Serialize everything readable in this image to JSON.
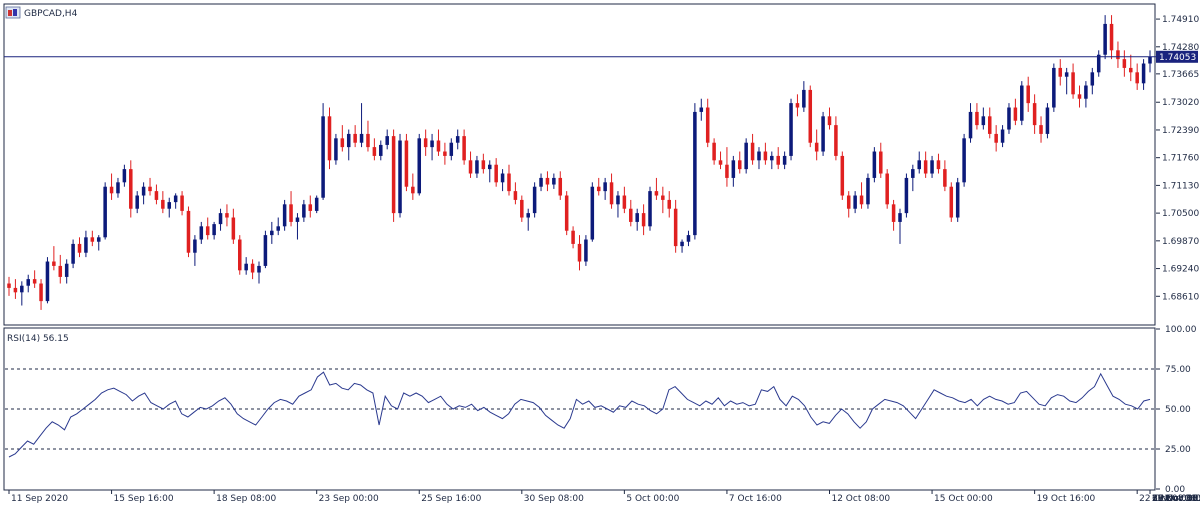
{
  "window": {
    "symbol_title": "GBPCAD,H4",
    "icon": "chart-window-icon"
  },
  "colors": {
    "bull": "#0c1a7a",
    "bear": "#e02020",
    "axis": "#1f2a44",
    "bid_line": "#1a237e",
    "rsi_line": "#2b3a8f",
    "price_tag_bg": "#1a237e",
    "price_tag_text": "#ffffff"
  },
  "chart_data": [
    {
      "type": "candlestick",
      "title": "GBPCAD,H4",
      "ylim": [
        1.6798,
        1.7523
      ],
      "y_ticks": [
        "1.74910",
        "1.74280",
        "1.73665",
        "1.73020",
        "1.72390",
        "1.71760",
        "1.71130",
        "1.70500",
        "1.69870",
        "1.69240",
        "1.68610"
      ],
      "current_price": "1.74053",
      "x_ticks": [
        "11 Sep 2020",
        "15 Sep 16:00",
        "18 Sep 08:00",
        "23 Sep 00:00",
        "25 Sep 16:00",
        "30 Sep 08:00",
        "5 Oct 00:00",
        "7 Oct 16:00",
        "12 Oct 08:00",
        "15 Oct 00:00",
        "19 Oct 16:00",
        "22 Oct 08:00",
        "27 Oct 00:00",
        "29 Oct 16:00",
        "3 Nov 08:00",
        "6 Nov 00:00",
        "10 Nov 16:00",
        "13 Nov 08:00",
        "18 Nov 00:00",
        "20 Nov 16:00",
        "25 Nov 08:00"
      ],
      "x_tick_candle_index": [
        0,
        16,
        32,
        48,
        64,
        80,
        96,
        112,
        128,
        144,
        160,
        176,
        192,
        208,
        224,
        240,
        256,
        272,
        288,
        304,
        320
      ],
      "candles_ohlc": [
        [
          1.689,
          1.6905,
          1.6862,
          1.688
        ],
        [
          1.688,
          1.69,
          1.6855,
          1.687
        ],
        [
          1.687,
          1.6895,
          1.684,
          1.6885
        ],
        [
          1.6885,
          1.691,
          1.687,
          1.69
        ],
        [
          1.69,
          1.692,
          1.688,
          1.689
        ],
        [
          1.689,
          1.69,
          1.683,
          1.685
        ],
        [
          1.685,
          1.695,
          1.6845,
          1.694
        ],
        [
          1.694,
          1.6975,
          1.692,
          1.693
        ],
        [
          1.693,
          1.6955,
          1.689,
          1.6905
        ],
        [
          1.6905,
          1.6945,
          1.689,
          1.6935
        ],
        [
          1.6935,
          1.699,
          1.6925,
          1.698
        ],
        [
          1.698,
          1.6995,
          1.695,
          1.696
        ],
        [
          1.696,
          1.701,
          1.695,
          1.6995
        ],
        [
          1.6995,
          1.701,
          1.6975,
          1.6985
        ],
        [
          1.6985,
          1.7,
          1.6965,
          1.6995
        ],
        [
          1.6995,
          1.712,
          1.699,
          1.711
        ],
        [
          1.711,
          1.714,
          1.708,
          1.7095
        ],
        [
          1.7095,
          1.713,
          1.7085,
          1.712
        ],
        [
          1.712,
          1.716,
          1.711,
          1.715
        ],
        [
          1.715,
          1.717,
          1.704,
          1.706
        ],
        [
          1.706,
          1.71,
          1.705,
          1.709
        ],
        [
          1.709,
          1.712,
          1.707,
          1.711
        ],
        [
          1.711,
          1.713,
          1.709,
          1.71
        ],
        [
          1.71,
          1.7115,
          1.707,
          1.708
        ],
        [
          1.708,
          1.71,
          1.705,
          1.706
        ],
        [
          1.706,
          1.7085,
          1.704,
          1.7075
        ],
        [
          1.7075,
          1.7095,
          1.706,
          1.709
        ],
        [
          1.709,
          1.71,
          1.7045,
          1.7055
        ],
        [
          1.7055,
          1.7065,
          1.695,
          1.696
        ],
        [
          1.696,
          1.7,
          1.693,
          1.699
        ],
        [
          1.699,
          1.703,
          1.698,
          1.702
        ],
        [
          1.702,
          1.704,
          1.699,
          1.7
        ],
        [
          1.7,
          1.703,
          1.699,
          1.7025
        ],
        [
          1.7025,
          1.706,
          1.701,
          1.705
        ],
        [
          1.705,
          1.707,
          1.702,
          1.704
        ],
        [
          1.704,
          1.706,
          1.698,
          1.699
        ],
        [
          1.699,
          1.7,
          1.691,
          1.692
        ],
        [
          1.692,
          1.695,
          1.691,
          1.6935
        ],
        [
          1.6935,
          1.6945,
          1.69,
          1.6915
        ],
        [
          1.6915,
          1.694,
          1.689,
          1.693
        ],
        [
          1.693,
          1.701,
          1.6925,
          1.7
        ],
        [
          1.7,
          1.703,
          1.698,
          1.701
        ],
        [
          1.701,
          1.704,
          1.7,
          1.702
        ],
        [
          1.702,
          1.708,
          1.701,
          1.707
        ],
        [
          1.707,
          1.71,
          1.702,
          1.703
        ],
        [
          1.703,
          1.705,
          1.699,
          1.704
        ],
        [
          1.704,
          1.708,
          1.703,
          1.707
        ],
        [
          1.707,
          1.709,
          1.704,
          1.7055
        ],
        [
          1.7055,
          1.709,
          1.705,
          1.7085
        ],
        [
          1.7085,
          1.73,
          1.708,
          1.727
        ],
        [
          1.727,
          1.729,
          1.715,
          1.717
        ],
        [
          1.717,
          1.723,
          1.716,
          1.722
        ],
        [
          1.722,
          1.725,
          1.719,
          1.72
        ],
        [
          1.72,
          1.724,
          1.717,
          1.723
        ],
        [
          1.723,
          1.725,
          1.72,
          1.721
        ],
        [
          1.721,
          1.73,
          1.72,
          1.723
        ],
        [
          1.723,
          1.726,
          1.719,
          1.72
        ],
        [
          1.72,
          1.722,
          1.717,
          1.718
        ],
        [
          1.718,
          1.7215,
          1.717,
          1.7205
        ],
        [
          1.7205,
          1.724,
          1.7195,
          1.7225
        ],
        [
          1.7225,
          1.724,
          1.703,
          1.705
        ],
        [
          1.705,
          1.723,
          1.704,
          1.7215
        ],
        [
          1.7215,
          1.723,
          1.71,
          1.711
        ],
        [
          1.711,
          1.714,
          1.708,
          1.7095
        ],
        [
          1.7095,
          1.723,
          1.709,
          1.722
        ],
        [
          1.722,
          1.724,
          1.718,
          1.72
        ],
        [
          1.72,
          1.723,
          1.717,
          1.7215
        ],
        [
          1.7215,
          1.724,
          1.718,
          1.719
        ],
        [
          1.719,
          1.721,
          1.716,
          1.718
        ],
        [
          1.718,
          1.722,
          1.717,
          1.721
        ],
        [
          1.721,
          1.724,
          1.7195,
          1.7225
        ],
        [
          1.7225,
          1.724,
          1.716,
          1.717
        ],
        [
          1.717,
          1.719,
          1.713,
          1.714
        ],
        [
          1.714,
          1.718,
          1.713,
          1.717
        ],
        [
          1.717,
          1.7185,
          1.714,
          1.715
        ],
        [
          1.715,
          1.717,
          1.712,
          1.716
        ],
        [
          1.716,
          1.7175,
          1.711,
          1.712
        ],
        [
          1.712,
          1.715,
          1.71,
          1.714
        ],
        [
          1.714,
          1.716,
          1.709,
          1.71
        ],
        [
          1.71,
          1.712,
          1.707,
          1.708
        ],
        [
          1.708,
          1.709,
          1.703,
          1.704
        ],
        [
          1.704,
          1.706,
          1.701,
          1.705
        ],
        [
          1.705,
          1.712,
          1.704,
          1.711
        ],
        [
          1.711,
          1.714,
          1.71,
          1.713
        ],
        [
          1.713,
          1.7145,
          1.71,
          1.7115
        ],
        [
          1.7115,
          1.714,
          1.7105,
          1.713
        ],
        [
          1.713,
          1.7145,
          1.708,
          1.709
        ],
        [
          1.709,
          1.71,
          1.7,
          1.701
        ],
        [
          1.701,
          1.702,
          1.697,
          1.698
        ],
        [
          1.698,
          1.7,
          1.692,
          1.694
        ],
        [
          1.694,
          1.7,
          1.693,
          1.699
        ],
        [
          1.699,
          1.712,
          1.6985,
          1.711
        ],
        [
          1.711,
          1.713,
          1.709,
          1.71
        ],
        [
          1.71,
          1.713,
          1.708,
          1.712
        ],
        [
          1.712,
          1.714,
          1.706,
          1.707
        ],
        [
          1.707,
          1.71,
          1.704,
          1.709
        ],
        [
          1.709,
          1.711,
          1.705,
          1.706
        ],
        [
          1.706,
          1.708,
          1.702,
          1.703
        ],
        [
          1.703,
          1.706,
          1.701,
          1.705
        ],
        [
          1.705,
          1.707,
          1.7,
          1.702
        ],
        [
          1.702,
          1.711,
          1.701,
          1.71
        ],
        [
          1.71,
          1.713,
          1.708,
          1.709
        ],
        [
          1.709,
          1.711,
          1.705,
          1.708
        ],
        [
          1.708,
          1.71,
          1.704,
          1.706
        ],
        [
          1.706,
          1.708,
          1.696,
          1.6975
        ],
        [
          1.6975,
          1.699,
          1.696,
          1.6985
        ],
        [
          1.6985,
          1.701,
          1.6975,
          1.7
        ],
        [
          1.7,
          1.73,
          1.699,
          1.728
        ],
        [
          1.728,
          1.731,
          1.726,
          1.729
        ],
        [
          1.729,
          1.731,
          1.72,
          1.721
        ],
        [
          1.721,
          1.722,
          1.716,
          1.717
        ],
        [
          1.717,
          1.719,
          1.715,
          1.716
        ],
        [
          1.716,
          1.72,
          1.711,
          1.713
        ],
        [
          1.713,
          1.718,
          1.711,
          1.717
        ],
        [
          1.717,
          1.719,
          1.714,
          1.715
        ],
        [
          1.715,
          1.722,
          1.714,
          1.721
        ],
        [
          1.721,
          1.723,
          1.716,
          1.717
        ],
        [
          1.717,
          1.72,
          1.715,
          1.719
        ],
        [
          1.719,
          1.721,
          1.716,
          1.717
        ],
        [
          1.717,
          1.719,
          1.715,
          1.718
        ],
        [
          1.718,
          1.72,
          1.715,
          1.716
        ],
        [
          1.716,
          1.719,
          1.715,
          1.718
        ],
        [
          1.718,
          1.731,
          1.717,
          1.73
        ],
        [
          1.73,
          1.732,
          1.727,
          1.729
        ],
        [
          1.729,
          1.735,
          1.728,
          1.733
        ],
        [
          1.733,
          1.734,
          1.72,
          1.721
        ],
        [
          1.721,
          1.724,
          1.717,
          1.719
        ],
        [
          1.719,
          1.728,
          1.718,
          1.727
        ],
        [
          1.727,
          1.729,
          1.724,
          1.725
        ],
        [
          1.725,
          1.727,
          1.717,
          1.718
        ],
        [
          1.718,
          1.719,
          1.708,
          1.709
        ],
        [
          1.709,
          1.71,
          1.704,
          1.706
        ],
        [
          1.706,
          1.71,
          1.705,
          1.709
        ],
        [
          1.709,
          1.712,
          1.706,
          1.707
        ],
        [
          1.707,
          1.714,
          1.706,
          1.713
        ],
        [
          1.713,
          1.72,
          1.712,
          1.719
        ],
        [
          1.719,
          1.721,
          1.713,
          1.714
        ],
        [
          1.714,
          1.715,
          1.706,
          1.707
        ],
        [
          1.707,
          1.708,
          1.701,
          1.703
        ],
        [
          1.703,
          1.706,
          1.698,
          1.705
        ],
        [
          1.705,
          1.714,
          1.704,
          1.713
        ],
        [
          1.713,
          1.716,
          1.71,
          1.715
        ],
        [
          1.715,
          1.719,
          1.714,
          1.717
        ],
        [
          1.717,
          1.719,
          1.713,
          1.714
        ],
        [
          1.714,
          1.718,
          1.713,
          1.717
        ],
        [
          1.717,
          1.7185,
          1.714,
          1.715
        ],
        [
          1.715,
          1.717,
          1.71,
          1.711
        ],
        [
          1.711,
          1.712,
          1.703,
          1.704
        ],
        [
          1.704,
          1.713,
          1.703,
          1.712
        ],
        [
          1.712,
          1.723,
          1.711,
          1.722
        ],
        [
          1.722,
          1.73,
          1.721,
          1.728
        ],
        [
          1.728,
          1.73,
          1.724,
          1.725
        ],
        [
          1.725,
          1.729,
          1.724,
          1.727
        ],
        [
          1.727,
          1.729,
          1.722,
          1.723
        ],
        [
          1.723,
          1.725,
          1.719,
          1.721
        ],
        [
          1.721,
          1.725,
          1.72,
          1.724
        ],
        [
          1.724,
          1.73,
          1.723,
          1.729
        ],
        [
          1.729,
          1.731,
          1.725,
          1.726
        ],
        [
          1.726,
          1.735,
          1.725,
          1.734
        ],
        [
          1.734,
          1.736,
          1.728,
          1.73
        ],
        [
          1.73,
          1.732,
          1.723,
          1.725
        ],
        [
          1.725,
          1.727,
          1.721,
          1.723
        ],
        [
          1.723,
          1.73,
          1.722,
          1.729
        ],
        [
          1.729,
          1.739,
          1.728,
          1.738
        ],
        [
          1.738,
          1.74,
          1.734,
          1.736
        ],
        [
          1.736,
          1.738,
          1.732,
          1.737
        ],
        [
          1.737,
          1.739,
          1.731,
          1.732
        ],
        [
          1.732,
          1.734,
          1.729,
          1.731
        ],
        [
          1.731,
          1.735,
          1.729,
          1.734
        ],
        [
          1.734,
          1.738,
          1.732,
          1.737
        ],
        [
          1.737,
          1.742,
          1.736,
          1.741
        ],
        [
          1.741,
          1.75,
          1.74,
          1.748
        ],
        [
          1.748,
          1.75,
          1.74,
          1.742
        ],
        [
          1.742,
          1.744,
          1.738,
          1.74
        ],
        [
          1.74,
          1.742,
          1.736,
          1.738
        ],
        [
          1.738,
          1.741,
          1.735,
          1.737
        ],
        [
          1.737,
          1.739,
          1.733,
          1.7345
        ],
        [
          1.7345,
          1.74,
          1.733,
          1.739
        ],
        [
          1.739,
          1.742,
          1.737,
          1.7405
        ]
      ]
    },
    {
      "type": "line",
      "title": "RSI(14) 56.15",
      "ylim": [
        0,
        100
      ],
      "y_ticks": [
        "100.00",
        "75.00",
        "50.00",
        "25.00",
        "0.00"
      ],
      "levels": [
        75,
        50,
        25
      ],
      "values": [
        20,
        22,
        26,
        30,
        28,
        33,
        38,
        42,
        40,
        37,
        45,
        47,
        50,
        53,
        56,
        60,
        62,
        63,
        61,
        59,
        55,
        58,
        60,
        54,
        52,
        50,
        53,
        55,
        47,
        45,
        48,
        51,
        50,
        52,
        55,
        57,
        53,
        47,
        44,
        42,
        40,
        45,
        50,
        54,
        56,
        55,
        53,
        58,
        60,
        62,
        70,
        73,
        65,
        66,
        63,
        62,
        66,
        65,
        62,
        60,
        40,
        58,
        52,
        50,
        60,
        58,
        60,
        58,
        54,
        56,
        58,
        53,
        50,
        52,
        51,
        53,
        49,
        51,
        48,
        46,
        44,
        47,
        53,
        56,
        55,
        54,
        51,
        46,
        43,
        40,
        38,
        44,
        56,
        53,
        55,
        51,
        52,
        50,
        48,
        52,
        51,
        55,
        53,
        52,
        49,
        47,
        50,
        62,
        64,
        60,
        56,
        54,
        52,
        55,
        53,
        57,
        52,
        55,
        53,
        54,
        52,
        53,
        62,
        61,
        64,
        56,
        52,
        58,
        56,
        52,
        45,
        40,
        42,
        41,
        46,
        50,
        47,
        42,
        38,
        42,
        50,
        53,
        56,
        55,
        54,
        52,
        48,
        44,
        50,
        56,
        62,
        60,
        58,
        57,
        55,
        54,
        56,
        52,
        56,
        58,
        56,
        55,
        53,
        54,
        60,
        61,
        57,
        53,
        52,
        57,
        59,
        58,
        55,
        54,
        57,
        61,
        64,
        72,
        65,
        58,
        56,
        53,
        52,
        50,
        55,
        56
      ]
    }
  ]
}
